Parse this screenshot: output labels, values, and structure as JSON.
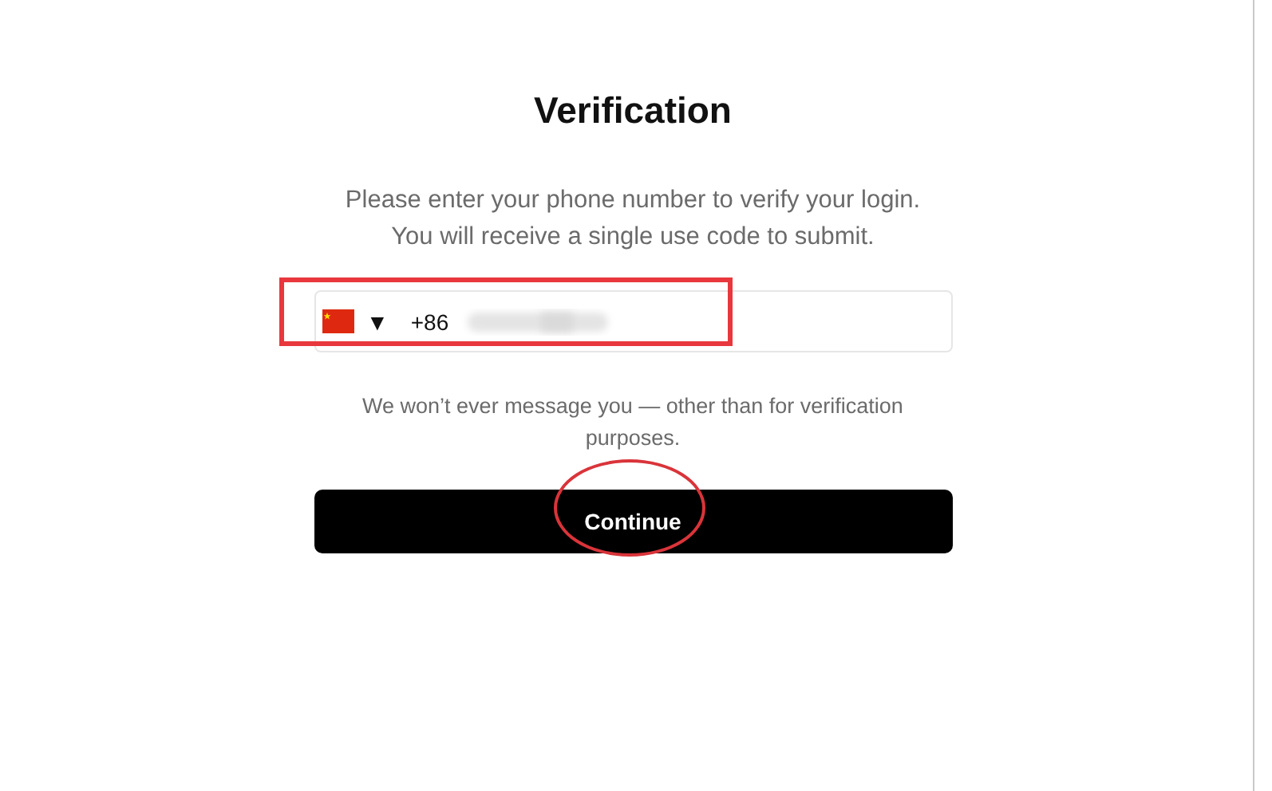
{
  "title": "Verification",
  "instructions": [
    "Please enter your phone number to verify your login.",
    "You will receive a single use code to submit."
  ],
  "phone_field": {
    "caret": "▼",
    "country_code": "+86",
    "value_redacted": true
  },
  "note": "We won’t ever message you — other than for verification purposes.",
  "continue_button": "Continue",
  "annotations": [
    {
      "kind": "rectangle"
    },
    {
      "kind": "ellipse"
    }
  ]
}
